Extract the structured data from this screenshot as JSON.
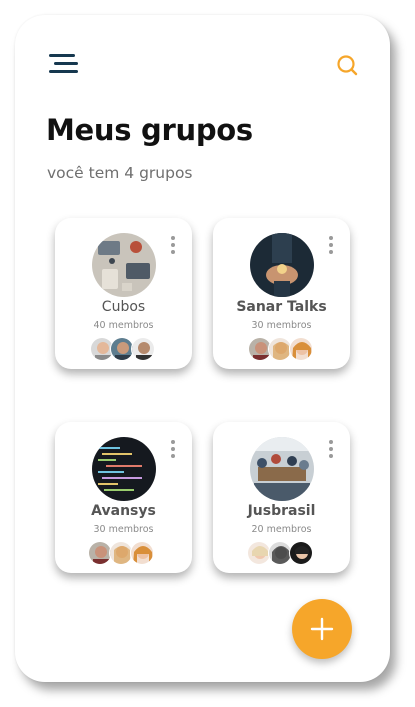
{
  "header": {
    "menu_icon": "menu-icon",
    "search_icon": "search-icon",
    "accent_color": "#f6a62a"
  },
  "page": {
    "title": "Meus grupos",
    "subtitle": "você tem 4 grupos"
  },
  "groups": [
    {
      "name": "Cubos",
      "members": "40 membros"
    },
    {
      "name": "Sanar Talks",
      "members": "30 membros"
    },
    {
      "name": "Avansys",
      "members": "30 membros"
    },
    {
      "name": "Jusbrasil",
      "members": "20 membros"
    }
  ],
  "fab": {
    "icon": "plus-icon",
    "color": "#f6a62a"
  }
}
